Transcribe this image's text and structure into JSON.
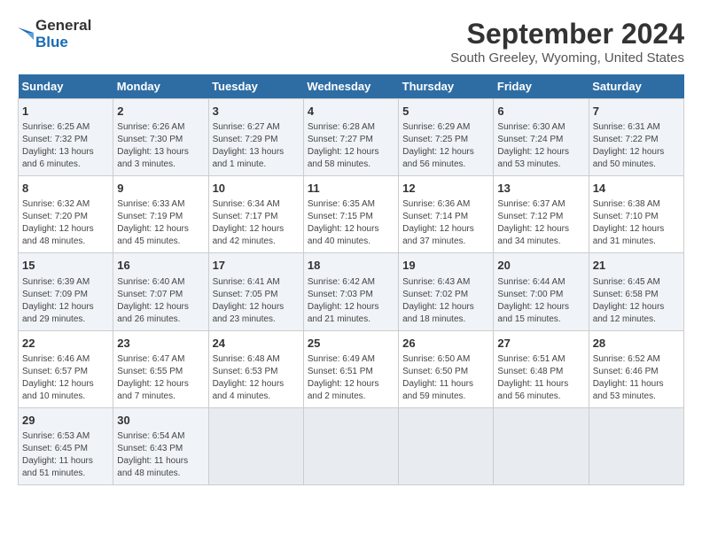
{
  "logo": {
    "line1": "General",
    "line2": "Blue"
  },
  "title": "September 2024",
  "subtitle": "South Greeley, Wyoming, United States",
  "header": {
    "colors": {
      "accent": "#2e6da4"
    }
  },
  "days_of_week": [
    "Sunday",
    "Monday",
    "Tuesday",
    "Wednesday",
    "Thursday",
    "Friday",
    "Saturday"
  ],
  "weeks": [
    [
      {
        "day": "1",
        "info": "Sunrise: 6:25 AM\nSunset: 7:32 PM\nDaylight: 13 hours and 6 minutes."
      },
      {
        "day": "2",
        "info": "Sunrise: 6:26 AM\nSunset: 7:30 PM\nDaylight: 13 hours and 3 minutes."
      },
      {
        "day": "3",
        "info": "Sunrise: 6:27 AM\nSunset: 7:29 PM\nDaylight: 13 hours and 1 minute."
      },
      {
        "day": "4",
        "info": "Sunrise: 6:28 AM\nSunset: 7:27 PM\nDaylight: 12 hours and 58 minutes."
      },
      {
        "day": "5",
        "info": "Sunrise: 6:29 AM\nSunset: 7:25 PM\nDaylight: 12 hours and 56 minutes."
      },
      {
        "day": "6",
        "info": "Sunrise: 6:30 AM\nSunset: 7:24 PM\nDaylight: 12 hours and 53 minutes."
      },
      {
        "day": "7",
        "info": "Sunrise: 6:31 AM\nSunset: 7:22 PM\nDaylight: 12 hours and 50 minutes."
      }
    ],
    [
      {
        "day": "8",
        "info": "Sunrise: 6:32 AM\nSunset: 7:20 PM\nDaylight: 12 hours and 48 minutes."
      },
      {
        "day": "9",
        "info": "Sunrise: 6:33 AM\nSunset: 7:19 PM\nDaylight: 12 hours and 45 minutes."
      },
      {
        "day": "10",
        "info": "Sunrise: 6:34 AM\nSunset: 7:17 PM\nDaylight: 12 hours and 42 minutes."
      },
      {
        "day": "11",
        "info": "Sunrise: 6:35 AM\nSunset: 7:15 PM\nDaylight: 12 hours and 40 minutes."
      },
      {
        "day": "12",
        "info": "Sunrise: 6:36 AM\nSunset: 7:14 PM\nDaylight: 12 hours and 37 minutes."
      },
      {
        "day": "13",
        "info": "Sunrise: 6:37 AM\nSunset: 7:12 PM\nDaylight: 12 hours and 34 minutes."
      },
      {
        "day": "14",
        "info": "Sunrise: 6:38 AM\nSunset: 7:10 PM\nDaylight: 12 hours and 31 minutes."
      }
    ],
    [
      {
        "day": "15",
        "info": "Sunrise: 6:39 AM\nSunset: 7:09 PM\nDaylight: 12 hours and 29 minutes."
      },
      {
        "day": "16",
        "info": "Sunrise: 6:40 AM\nSunset: 7:07 PM\nDaylight: 12 hours and 26 minutes."
      },
      {
        "day": "17",
        "info": "Sunrise: 6:41 AM\nSunset: 7:05 PM\nDaylight: 12 hours and 23 minutes."
      },
      {
        "day": "18",
        "info": "Sunrise: 6:42 AM\nSunset: 7:03 PM\nDaylight: 12 hours and 21 minutes."
      },
      {
        "day": "19",
        "info": "Sunrise: 6:43 AM\nSunset: 7:02 PM\nDaylight: 12 hours and 18 minutes."
      },
      {
        "day": "20",
        "info": "Sunrise: 6:44 AM\nSunset: 7:00 PM\nDaylight: 12 hours and 15 minutes."
      },
      {
        "day": "21",
        "info": "Sunrise: 6:45 AM\nSunset: 6:58 PM\nDaylight: 12 hours and 12 minutes."
      }
    ],
    [
      {
        "day": "22",
        "info": "Sunrise: 6:46 AM\nSunset: 6:57 PM\nDaylight: 12 hours and 10 minutes."
      },
      {
        "day": "23",
        "info": "Sunrise: 6:47 AM\nSunset: 6:55 PM\nDaylight: 12 hours and 7 minutes."
      },
      {
        "day": "24",
        "info": "Sunrise: 6:48 AM\nSunset: 6:53 PM\nDaylight: 12 hours and 4 minutes."
      },
      {
        "day": "25",
        "info": "Sunrise: 6:49 AM\nSunset: 6:51 PM\nDaylight: 12 hours and 2 minutes."
      },
      {
        "day": "26",
        "info": "Sunrise: 6:50 AM\nSunset: 6:50 PM\nDaylight: 11 hours and 59 minutes."
      },
      {
        "day": "27",
        "info": "Sunrise: 6:51 AM\nSunset: 6:48 PM\nDaylight: 11 hours and 56 minutes."
      },
      {
        "day": "28",
        "info": "Sunrise: 6:52 AM\nSunset: 6:46 PM\nDaylight: 11 hours and 53 minutes."
      }
    ],
    [
      {
        "day": "29",
        "info": "Sunrise: 6:53 AM\nSunset: 6:45 PM\nDaylight: 11 hours and 51 minutes."
      },
      {
        "day": "30",
        "info": "Sunrise: 6:54 AM\nSunset: 6:43 PM\nDaylight: 11 hours and 48 minutes."
      },
      null,
      null,
      null,
      null,
      null
    ]
  ]
}
